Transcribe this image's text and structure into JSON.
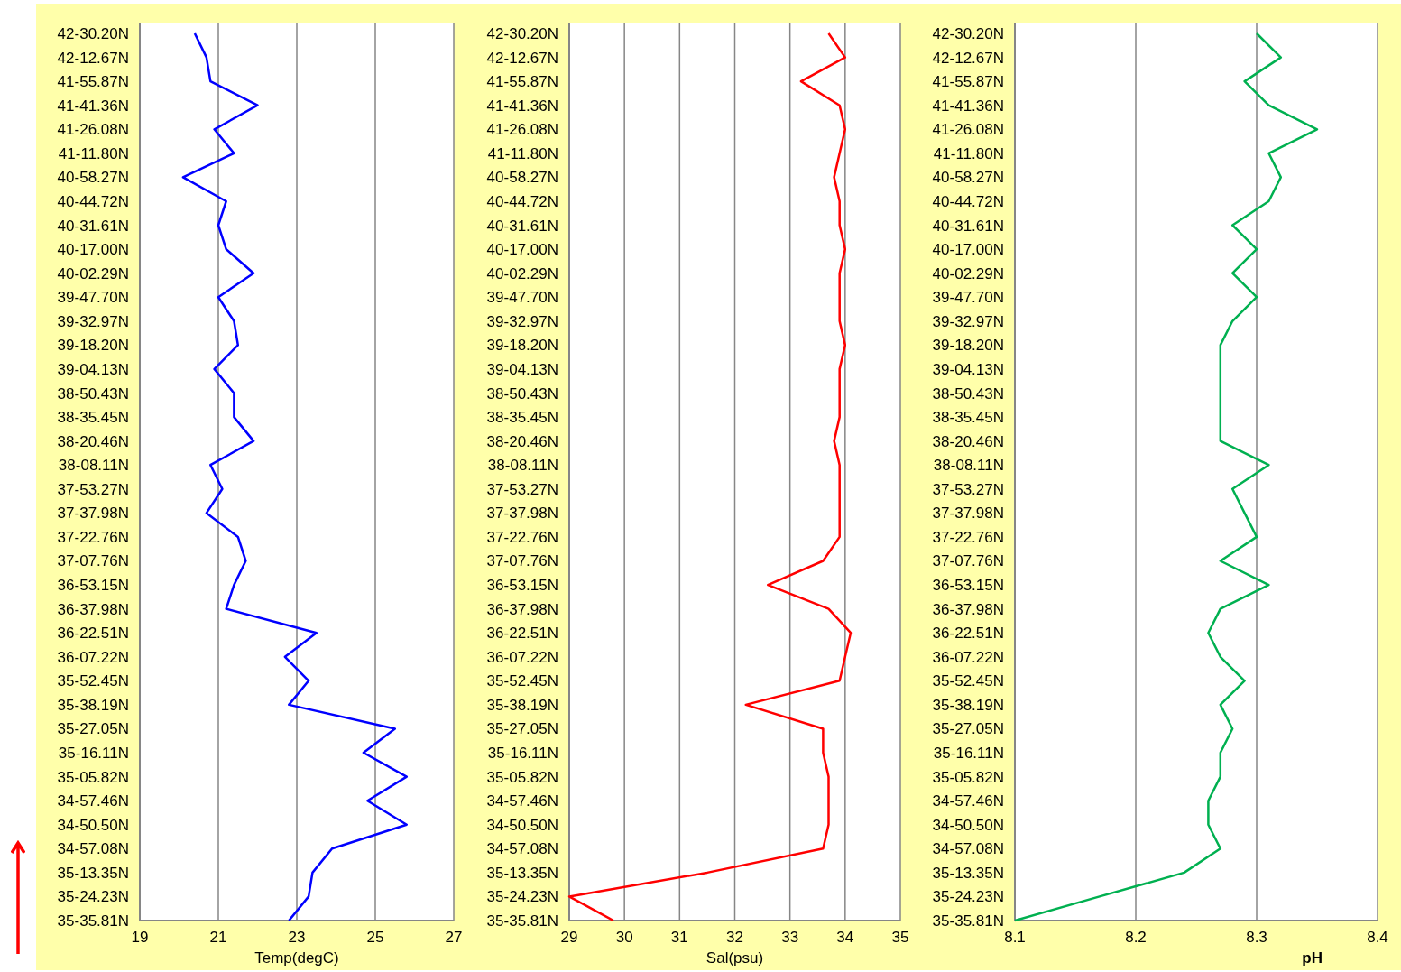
{
  "charts": [
    {
      "chart_data": {
        "type": "line",
        "orientation": "horizontal",
        "xlabel": "Temp(degC)",
        "grid": true,
        "xlim": [
          19,
          27
        ],
        "xticks": [
          19,
          21,
          23,
          25,
          27
        ],
        "categories": [
          "42-30.20N",
          "42-12.67N",
          "41-55.87N",
          "41-41.36N",
          "41-26.08N",
          "41-11.80N",
          "40-58.27N",
          "40-44.72N",
          "40-31.61N",
          "40-17.00N",
          "40-02.29N",
          "39-47.70N",
          "39-32.97N",
          "39-18.20N",
          "39-04.13N",
          "38-50.43N",
          "38-35.45N",
          "38-20.46N",
          "38-08.11N",
          "37-53.27N",
          "37-37.98N",
          "37-22.76N",
          "37-07.76N",
          "36-53.15N",
          "36-37.98N",
          "36-22.51N",
          "36-07.22N",
          "35-52.45N",
          "35-38.19N",
          "35-27.05N",
          "35-16.11N",
          "35-05.82N",
          "34-57.46N",
          "34-50.50N",
          "34-57.08N",
          "35-13.35N",
          "35-24.23N",
          "35-35.81N"
        ],
        "series": [
          {
            "color": "#0000ff",
            "values": [
              20.4,
              20.7,
              20.8,
              22.0,
              20.9,
              21.4,
              20.1,
              21.2,
              21.0,
              21.2,
              21.9,
              21.0,
              21.4,
              21.5,
              20.9,
              21.4,
              21.4,
              21.9,
              20.8,
              21.1,
              20.7,
              21.5,
              21.7,
              21.4,
              21.2,
              23.5,
              22.7,
              23.3,
              22.8,
              25.5,
              24.7,
              25.8,
              24.8,
              25.8,
              23.9,
              23.4,
              23.3,
              22.8
            ]
          }
        ]
      }
    },
    {
      "chart_data": {
        "type": "line",
        "orientation": "horizontal",
        "xlabel": "Sal(psu)",
        "grid": true,
        "xlim": [
          29,
          35
        ],
        "xticks": [
          29,
          30,
          31,
          32,
          33,
          34,
          35
        ],
        "categories": [
          "42-30.20N",
          "42-12.67N",
          "41-55.87N",
          "41-41.36N",
          "41-26.08N",
          "41-11.80N",
          "40-58.27N",
          "40-44.72N",
          "40-31.61N",
          "40-17.00N",
          "40-02.29N",
          "39-47.70N",
          "39-32.97N",
          "39-18.20N",
          "39-04.13N",
          "38-50.43N",
          "38-35.45N",
          "38-20.46N",
          "38-08.11N",
          "37-53.27N",
          "37-37.98N",
          "37-22.76N",
          "37-07.76N",
          "36-53.15N",
          "36-37.98N",
          "36-22.51N",
          "36-07.22N",
          "35-52.45N",
          "35-38.19N",
          "35-27.05N",
          "35-16.11N",
          "35-05.82N",
          "34-57.46N",
          "34-50.50N",
          "34-57.08N",
          "35-13.35N",
          "35-24.23N",
          "35-35.81N"
        ],
        "series": [
          {
            "color": "#ff0000",
            "values": [
              33.7,
              34.0,
              33.2,
              33.9,
              34.0,
              33.9,
              33.8,
              33.9,
              33.9,
              34.0,
              33.9,
              33.9,
              33.9,
              34.0,
              33.9,
              33.9,
              33.9,
              33.8,
              33.9,
              33.9,
              33.9,
              33.9,
              33.6,
              32.6,
              33.7,
              34.1,
              34.0,
              33.9,
              32.2,
              33.6,
              33.6,
              33.7,
              33.7,
              33.7,
              33.6,
              31.5,
              29.0,
              29.8
            ]
          }
        ]
      }
    },
    {
      "chart_data": {
        "type": "line",
        "orientation": "horizontal",
        "xlabel": "pH",
        "grid": true,
        "xlim": [
          8.1,
          8.4
        ],
        "xticks": [
          8.1,
          8.2,
          8.3,
          8.4
        ],
        "categories": [
          "42-30.20N",
          "42-12.67N",
          "41-55.87N",
          "41-41.36N",
          "41-26.08N",
          "41-11.80N",
          "40-58.27N",
          "40-44.72N",
          "40-31.61N",
          "40-17.00N",
          "40-02.29N",
          "39-47.70N",
          "39-32.97N",
          "39-18.20N",
          "39-04.13N",
          "38-50.43N",
          "38-35.45N",
          "38-20.46N",
          "38-08.11N",
          "37-53.27N",
          "37-37.98N",
          "37-22.76N",
          "37-07.76N",
          "36-53.15N",
          "36-37.98N",
          "36-22.51N",
          "36-07.22N",
          "35-52.45N",
          "35-38.19N",
          "35-27.05N",
          "35-16.11N",
          "35-05.82N",
          "34-57.46N",
          "34-50.50N",
          "34-57.08N",
          "35-13.35N",
          "35-24.23N",
          "35-35.81N"
        ],
        "series": [
          {
            "color": "#00b050",
            "values": [
              8.3,
              8.32,
              8.29,
              8.31,
              8.35,
              8.31,
              8.32,
              8.31,
              8.28,
              8.3,
              8.28,
              8.3,
              8.28,
              8.27,
              8.27,
              8.27,
              8.27,
              8.27,
              8.31,
              8.28,
              8.29,
              8.3,
              8.27,
              8.31,
              8.27,
              8.26,
              8.27,
              8.29,
              8.27,
              8.28,
              8.27,
              8.27,
              8.26,
              8.26,
              8.27,
              8.24,
              8.17,
              8.1
            ]
          }
        ]
      }
    }
  ]
}
